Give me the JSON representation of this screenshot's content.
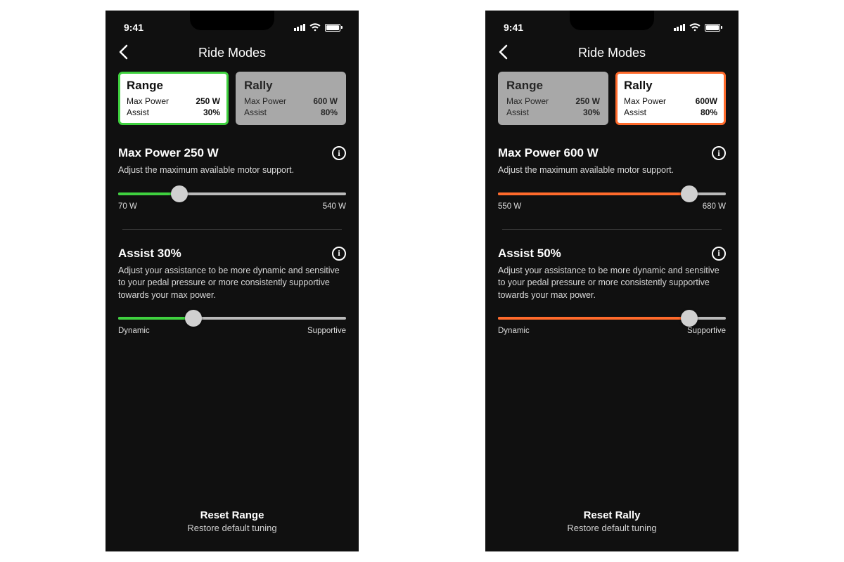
{
  "status": {
    "time": "9:41"
  },
  "header": {
    "title": "Ride Modes"
  },
  "screens": [
    {
      "accent": "#3fd13f",
      "cards": [
        {
          "selected": true,
          "title": "Range",
          "maxPowerLabel": "Max Power",
          "maxPowerValue": "250 W",
          "assistLabel": "Assist",
          "assistValue": "30%"
        },
        {
          "selected": false,
          "title": "Rally",
          "maxPowerLabel": "Max Power",
          "maxPowerValue": "600 W",
          "assistLabel": "Assist",
          "assistValue": "80%"
        }
      ],
      "sections": [
        {
          "title": "Max Power 250 W",
          "desc": "Adjust the maximum available motor support.",
          "percent": 27,
          "minLabel": "70 W",
          "maxLabel": "540 W"
        },
        {
          "title": "Assist 30%",
          "desc": "Adjust your assistance to be more dynamic and sensitive to your pedal pressure or more consistently supportive towards your max power.",
          "percent": 33,
          "minLabel": "Dynamic",
          "maxLabel": "Supportive"
        }
      ],
      "reset": {
        "title": "Reset Range",
        "sub": "Restore default tuning"
      }
    },
    {
      "accent": "#ff6a2b",
      "cards": [
        {
          "selected": false,
          "title": "Range",
          "maxPowerLabel": "Max Power",
          "maxPowerValue": "250 W",
          "assistLabel": "Assist",
          "assistValue": "30%"
        },
        {
          "selected": true,
          "title": "Rally",
          "maxPowerLabel": "Max Power",
          "maxPowerValue": "600W",
          "assistLabel": "Assist",
          "assistValue": "80%"
        }
      ],
      "sections": [
        {
          "title": "Max Power 600 W",
          "desc": "Adjust the maximum available motor support.",
          "percent": 84,
          "minLabel": "550 W",
          "maxLabel": "680 W"
        },
        {
          "title": "Assist 50%",
          "desc": "Adjust your assistance to be more dynamic and sensitive to your pedal pressure or more consistently supportive towards your max power.",
          "percent": 84,
          "minLabel": "Dynamic",
          "maxLabel": "Supportive"
        }
      ],
      "reset": {
        "title": "Reset Rally",
        "sub": "Restore default tuning"
      }
    }
  ]
}
